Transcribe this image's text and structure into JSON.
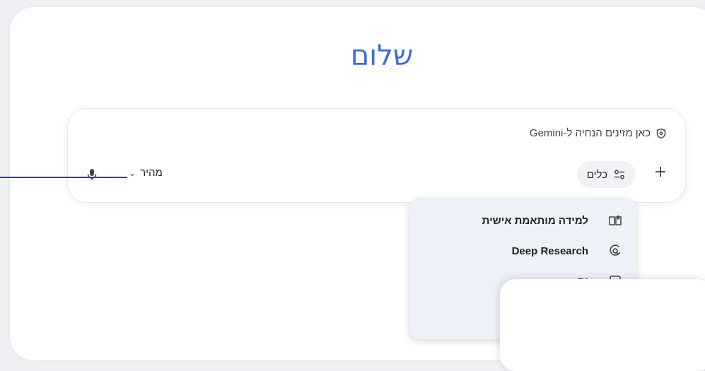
{
  "greeting": "שלום",
  "input": {
    "prompt_text": "כאן מזינים הנחיה ל-Gemini",
    "tools_label": "כלים",
    "model_label": "מהיר"
  },
  "menu": {
    "items": [
      {
        "label": "למידה מותאמת אישית",
        "icon": "learning-book-icon"
      },
      {
        "label": "Deep Research",
        "icon": "deep-research-icon"
      },
      {
        "label": "ות",
        "icon": "item-icon"
      }
    ]
  },
  "colors": {
    "greeting": "#3f6be0",
    "annotation_line": "#2b36e0",
    "menu_bg": "#eef1f7"
  }
}
